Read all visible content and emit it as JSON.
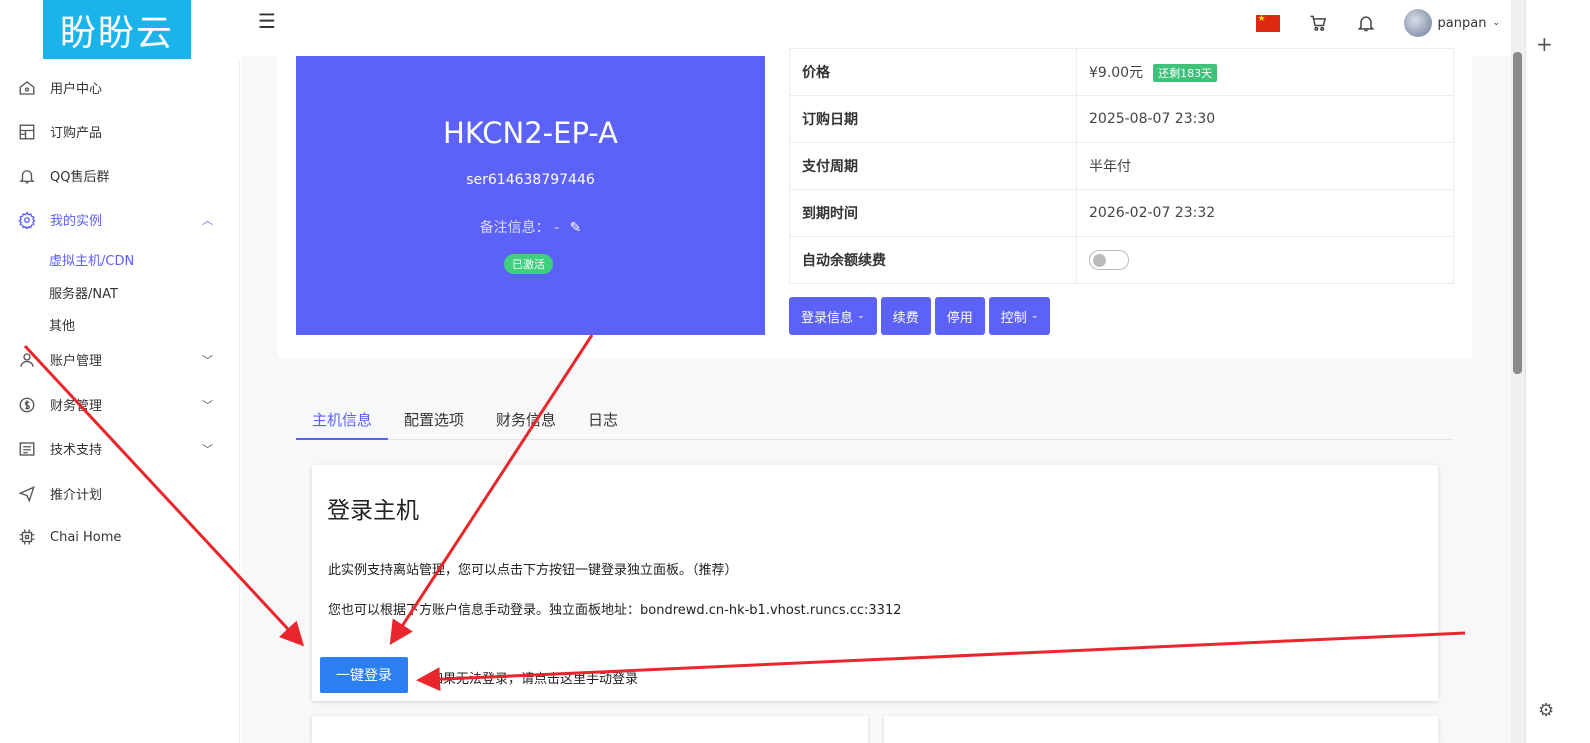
{
  "brand": {
    "logo_text": "盼盼云",
    "color": "#1ab3ea"
  },
  "header": {
    "menu_icon": "hamburger-icon",
    "flag": "china-flag",
    "cart_icon": "cart-icon",
    "bell_icon": "bell-icon",
    "username": "panpan"
  },
  "sidebar": {
    "items": [
      {
        "label": "用户中心",
        "icon": "home-icon"
      },
      {
        "label": "订购产品",
        "icon": "grid-icon"
      },
      {
        "label": "QQ售后群",
        "icon": "bell-icon"
      },
      {
        "label": "我的实例",
        "icon": "gear-icon"
      },
      {
        "label": "账户管理",
        "icon": "user-icon"
      },
      {
        "label": "财务管理",
        "icon": "dollar-icon"
      },
      {
        "label": "技术支持",
        "icon": "doc-icon"
      },
      {
        "label": "推介计划",
        "icon": "send-icon"
      },
      {
        "label": "Chai Home",
        "icon": "chip-icon"
      }
    ],
    "submenu": [
      "虚拟主机/CDN",
      "服务器/NAT",
      "其他"
    ]
  },
  "instance": {
    "name": "HKCN2-EP-A",
    "serial": "ser614638797446",
    "note": "备注信息：  -",
    "status": "已激活"
  },
  "details": {
    "rows": [
      {
        "k": "价格",
        "v": "¥9.00元",
        "badge": "还剩183天"
      },
      {
        "k": "订购日期",
        "v": "2025-08-07 23:30"
      },
      {
        "k": "支付周期",
        "v": "半年付"
      },
      {
        "k": "到期时间",
        "v": "2026-02-07 23:32"
      },
      {
        "k": "自动余额续费",
        "v": ""
      }
    ],
    "auto_renew": false
  },
  "actions": {
    "login": "登录信息",
    "renew": "续费",
    "stop": "停用",
    "control": "控制"
  },
  "tabs": [
    "主机信息",
    "配置选项",
    "财务信息",
    "日志"
  ],
  "login_card": {
    "title": "登录主机",
    "p1": "此实例支持离站管理，您可以点击下方按钮一键登录独立面板。（推荐）",
    "p2": "您也可以根据下方账户信息手动登录。独立面板地址：bondrewd.cn-hk-b1.vhost.runcs.cc:3312",
    "button": "一键登录",
    "manual": "如果无法登录，请点击这里手动登录"
  },
  "colors": {
    "primary": "#5c62f8",
    "success": "#3ed07d",
    "button_blue": "#2b7ff0",
    "arrow": "#e8262b"
  }
}
